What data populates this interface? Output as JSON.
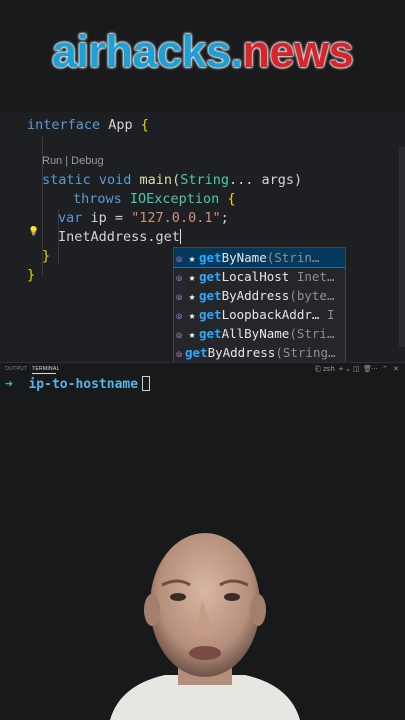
{
  "banner": {
    "word1": "airhacks",
    "dot": ".",
    "word2": "news"
  },
  "editor": {
    "codelens": "Run | Debug",
    "lines": {
      "l1_kw": "interface",
      "l1_name": " App ",
      "l1_brace": "{",
      "l3_kw1": "static",
      "l3_kw2": " void",
      "l3_main": " main",
      "l3_paren": "(",
      "l3_type": "String",
      "l3_rest": "... args)",
      "l4_kw": "throws",
      "l4_type": " IOException",
      "l4_brace": " {",
      "l5_kw": "var",
      "l5_mid": " ip = ",
      "l5_str": "\"127.0.0.1\"",
      "l5_end": ";",
      "l6_text": "InetAddress.get",
      "l7_brace": "}",
      "l8_brace": "}"
    }
  },
  "suggestions": [
    {
      "match": "get",
      "rest": "ByName",
      "detail": "(Strin…",
      "starred": true,
      "selected": true,
      "icon": "method-icon"
    },
    {
      "match": "get",
      "rest": "LocalHost",
      "detail": "  Inet…",
      "starred": true,
      "selected": false,
      "icon": "method-icon"
    },
    {
      "match": "get",
      "rest": "ByAddress",
      "detail": "(byte…",
      "starred": true,
      "selected": false,
      "icon": "method-icon"
    },
    {
      "match": "get",
      "rest": "LoopbackAddr…",
      "detail": "  I",
      "starred": true,
      "selected": false,
      "icon": "method-icon"
    },
    {
      "match": "get",
      "rest": "AllByName",
      "detail": "(Stri…",
      "starred": true,
      "selected": false,
      "icon": "method-icon"
    },
    {
      "match": "get",
      "rest": "ByAddress",
      "detail": "(String…",
      "starred": false,
      "selected": false,
      "icon": "method-icon"
    }
  ],
  "panel": {
    "tab_output": "OUTPUT",
    "tab_terminal": "TERMINAL",
    "shell": "zsh",
    "prompt_arrow": "➜",
    "prompt_dir": "ip-to-hostname"
  },
  "colors": {
    "accent_blue": "#1e9fd6",
    "accent_red": "#d9242b",
    "selection": "#04395e"
  }
}
